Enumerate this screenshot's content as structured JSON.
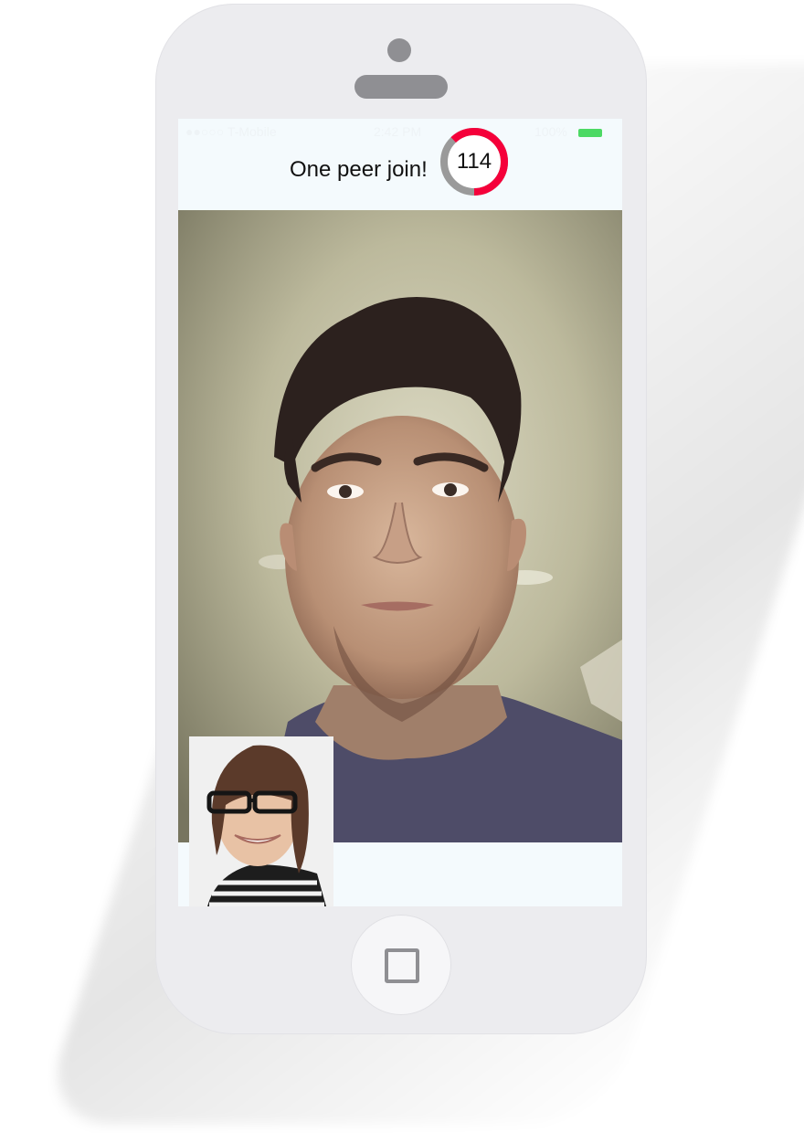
{
  "status_bar": {
    "carrier": "●●○○○ T-Mobile",
    "time": "2:42 PM",
    "battery_text": "100%",
    "battery_color": "#4cd964"
  },
  "nav": {
    "title": "One peer join!"
  },
  "timer": {
    "value": "114",
    "progress_fraction": 0.62,
    "active_color": "#f5003a",
    "track_color": "#9a9a9a"
  },
  "remote_video": {
    "participant": "remote-peer"
  },
  "local_video": {
    "participant": "self-preview"
  },
  "device": {
    "home_button_icon": "home-square-icon"
  }
}
